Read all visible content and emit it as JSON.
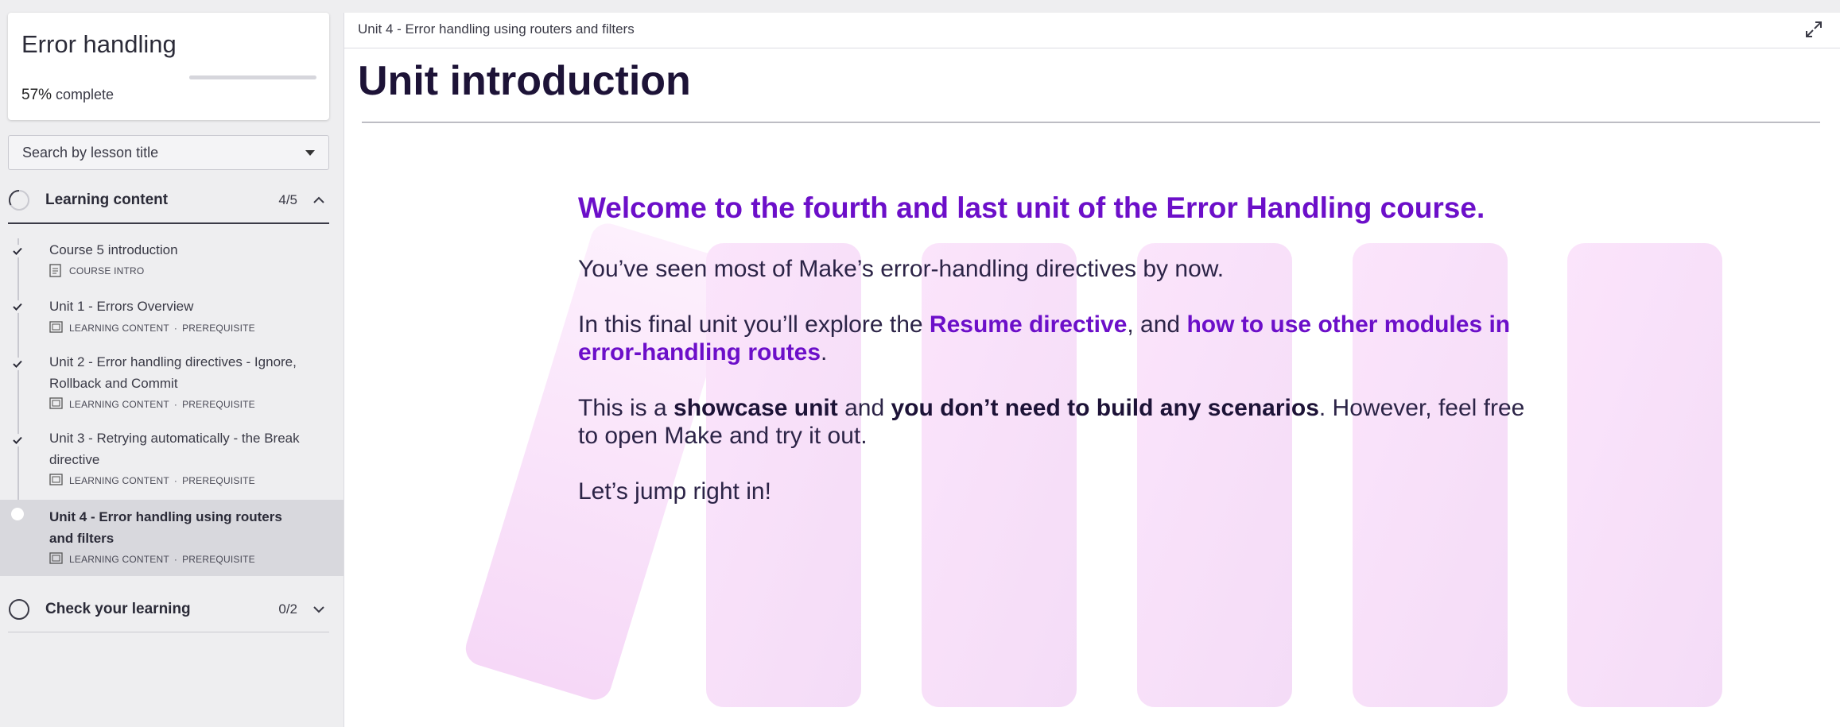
{
  "sidebar": {
    "course_title": "Error handling",
    "progress_pct": "57%",
    "progress_suffix": " complete",
    "progress_value": 0.57,
    "search_placeholder": "Search by lesson title",
    "sections": [
      {
        "title": "Learning content",
        "count": "4/5",
        "expanded": true
      },
      {
        "title": "Check your learning",
        "count": "0/2",
        "expanded": false
      }
    ],
    "lessons": [
      {
        "title": "Course 5 introduction",
        "type": "COURSE INTRO",
        "prereq": "",
        "done": true,
        "icon": "document-icon"
      },
      {
        "title": "Unit 1 - Errors Overview",
        "type": "LEARNING CONTENT",
        "prereq": "PREREQUISITE",
        "done": true,
        "icon": "slides-icon"
      },
      {
        "title": "Unit 2 - Error handling directives - Ignore, Rollback and Commit",
        "type": "LEARNING CONTENT",
        "prereq": "PREREQUISITE",
        "done": true,
        "icon": "slides-icon"
      },
      {
        "title": "Unit 3 - Retrying automatically - the Break directive",
        "type": "LEARNING CONTENT",
        "prereq": "PREREQUISITE",
        "done": true,
        "icon": "slides-icon"
      },
      {
        "title": "Unit 4 - Error handling using routers and filters",
        "type": "LEARNING CONTENT",
        "prereq": "PREREQUISITE",
        "done": false,
        "active": true,
        "icon": "slides-icon"
      }
    ],
    "separator": "·"
  },
  "main": {
    "breadcrumb": "Unit 4 - Error handling using routers and filters",
    "page_title": "Unit introduction",
    "welcome": "Welcome to the fourth and last unit of the Error Handling course.",
    "para1": "You’ve seen most of Make’s error-handling directives by now.",
    "para2_a": "In this final unit you’ll explore the ",
    "para2_hl1": "Resume directive",
    "para2_b": ", and ",
    "para2_hl2": "how to use other modules in error-handling routes",
    "para2_c": ".",
    "para3_a": "This is a ",
    "para3_s1": "showcase unit",
    "para3_b": " and ",
    "para3_s2": "you don’t need to build any scenarios",
    "para3_c": ". However, feel free to open Make and try it out.",
    "para4": "Let’s jump right in!"
  },
  "colors": {
    "accent": "#6c0fc9",
    "heading": "#1d1337",
    "bar_pink": "#f7d6f7"
  }
}
